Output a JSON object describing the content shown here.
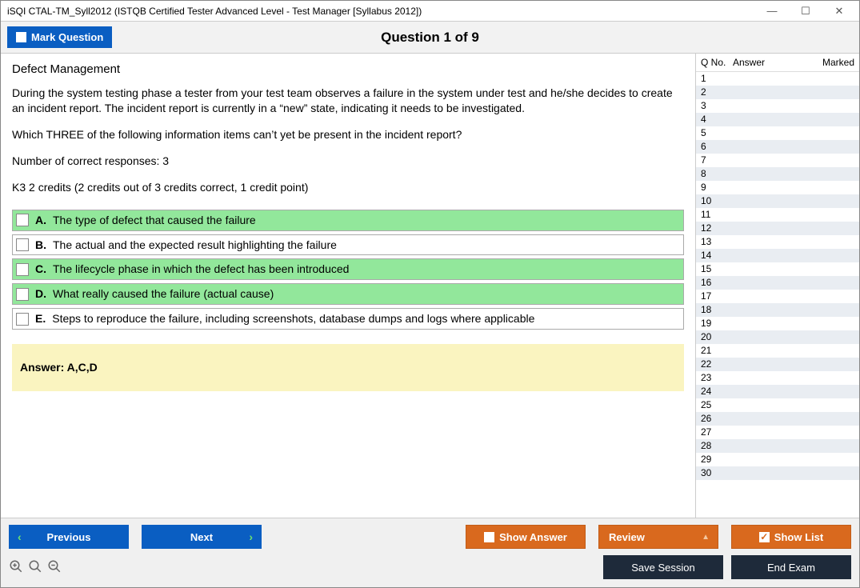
{
  "window": {
    "title": "iSQI CTAL-TM_Syll2012 (ISTQB Certified Tester Advanced Level - Test Manager [Syllabus 2012])"
  },
  "header": {
    "mark_label": "Mark Question",
    "question_title": "Question 1 of 9"
  },
  "question": {
    "topic": "Defect Management",
    "stem_p1": "During the system testing phase a tester from your test team observes a failure in the system under test and he/she decides to create an incident report. The incident report is currently in a “new” state, indicating it needs to be investigated.",
    "stem_p2": "Which THREE of the following information items can’t yet be present in the incident report?",
    "stem_p3": "Number of correct responses: 3",
    "stem_p4": "K3 2 credits (2 credits out of 3 credits correct, 1 credit point)",
    "options": [
      {
        "letter": "A.",
        "text": "The type of defect that caused the failure",
        "correct": true
      },
      {
        "letter": "B.",
        "text": "The actual and the expected result highlighting the failure",
        "correct": false
      },
      {
        "letter": "C.",
        "text": "The lifecycle phase in which the defect has been introduced",
        "correct": true
      },
      {
        "letter": "D.",
        "text": "What really caused the failure (actual cause)",
        "correct": true
      },
      {
        "letter": "E.",
        "text": "Steps to reproduce the failure, including screenshots, database dumps and logs where applicable",
        "correct": false
      }
    ],
    "answer_label": "Answer: A,C,D"
  },
  "side": {
    "col_qno": "Q No.",
    "col_answer": "Answer",
    "col_marked": "Marked",
    "rows": 30
  },
  "footer": {
    "previous": "Previous",
    "next": "Next",
    "show_answer": "Show Answer",
    "review": "Review",
    "show_list": "Show List",
    "save_session": "Save Session",
    "end_exam": "End Exam"
  }
}
